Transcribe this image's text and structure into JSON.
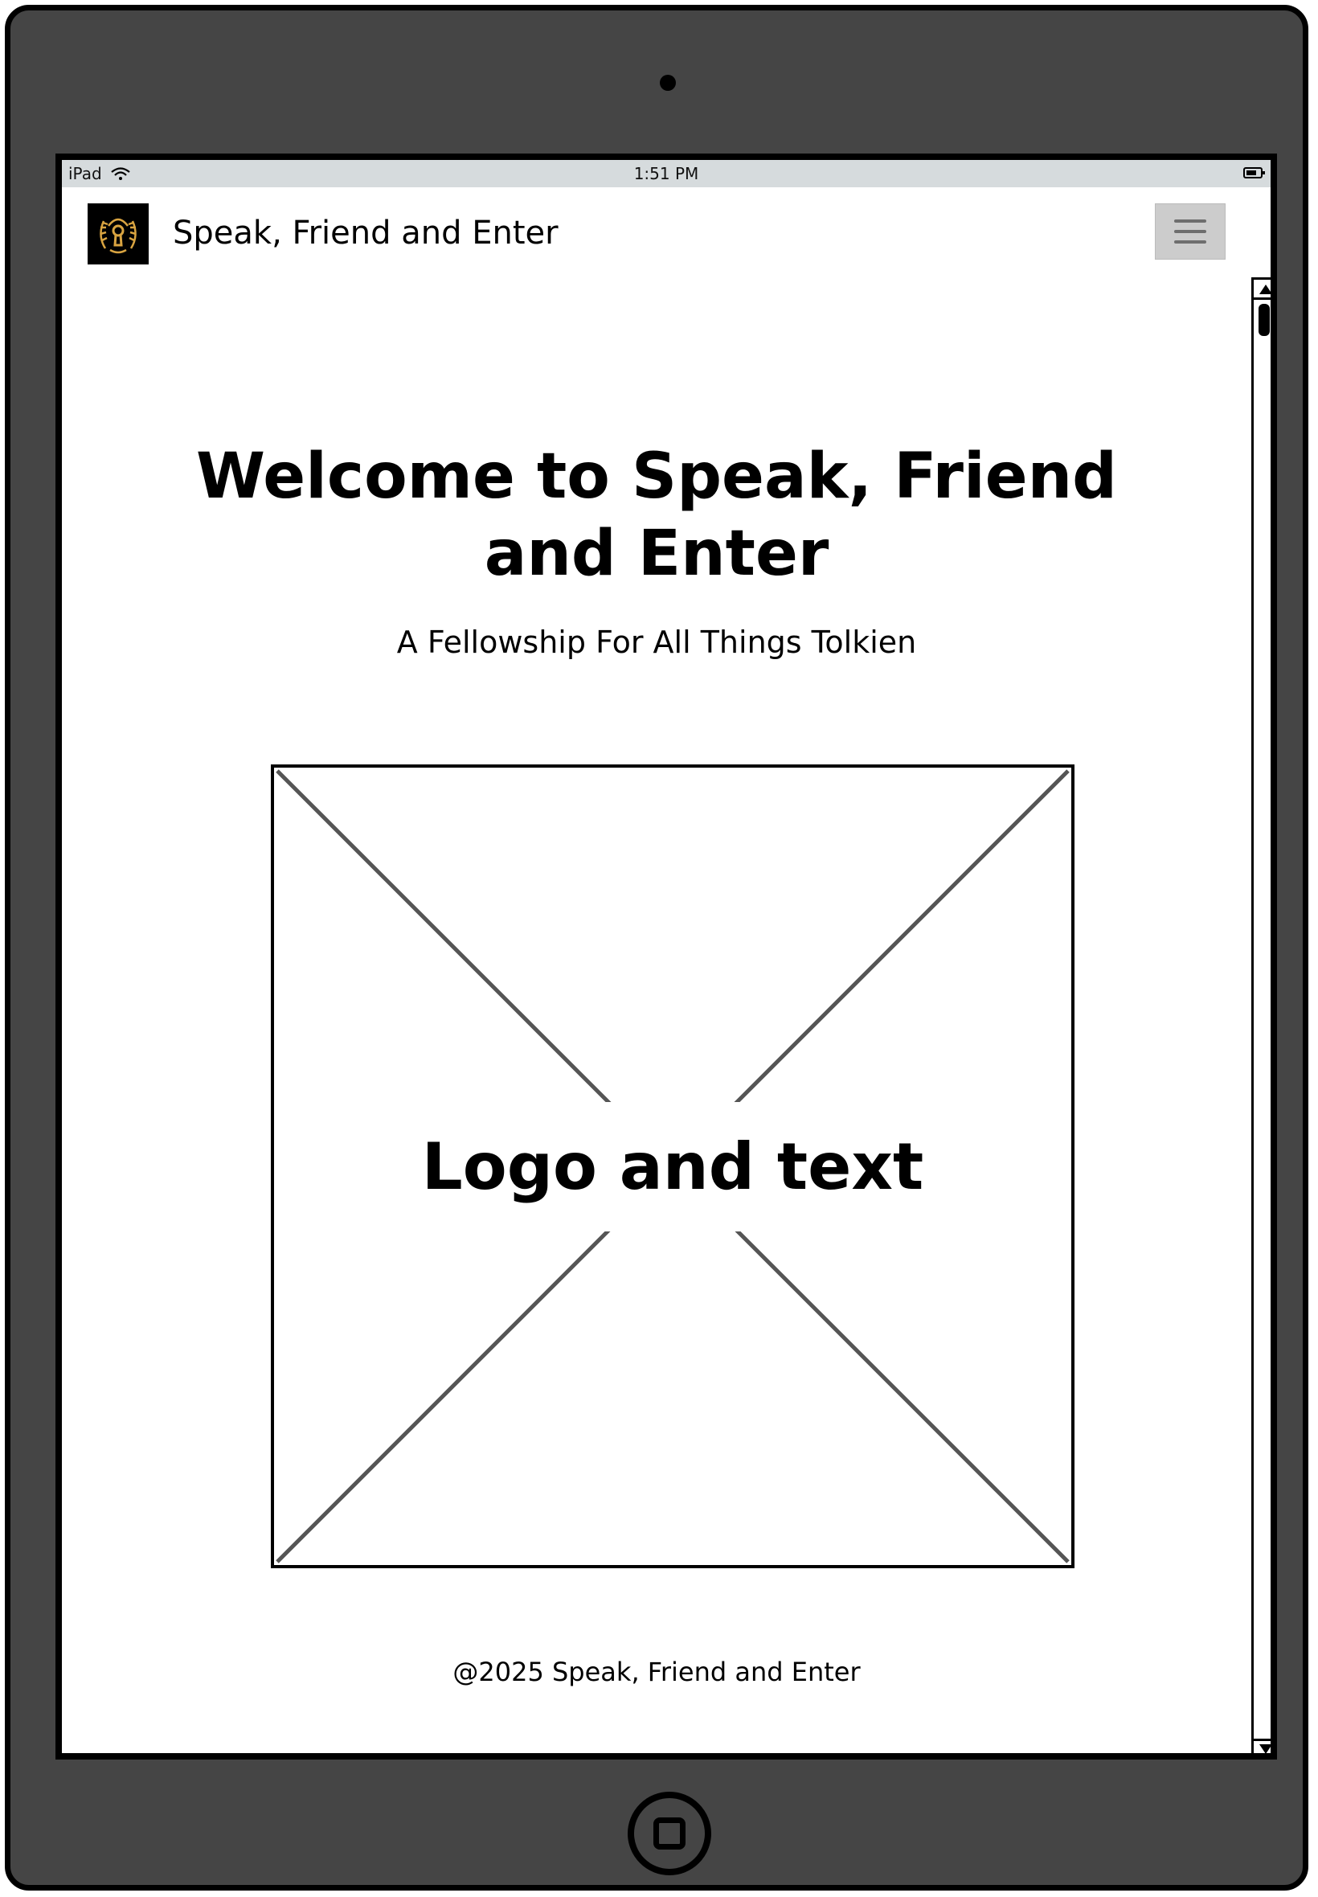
{
  "status_bar": {
    "device": "iPad",
    "time": "1:51 PM"
  },
  "navbar": {
    "brand_title": "Speak, Friend and Enter",
    "logo_icon": "keyhole-laurel-icon",
    "menu_icon": "hamburger-menu-icon",
    "colors": {
      "logo_bg": "#000000",
      "logo_gold": "#d9a441",
      "menu_bg": "#cccccc"
    }
  },
  "hero": {
    "title": "Welcome to Speak, Friend and Enter",
    "subtitle": "A Fellowship For All Things Tolkien"
  },
  "placeholder": {
    "label": "Logo and text"
  },
  "footer": {
    "copyright": "@2025 Speak, Friend and Enter"
  },
  "device": {
    "frame_color": "#454545",
    "status_bar_color": "#d6dbdd"
  }
}
